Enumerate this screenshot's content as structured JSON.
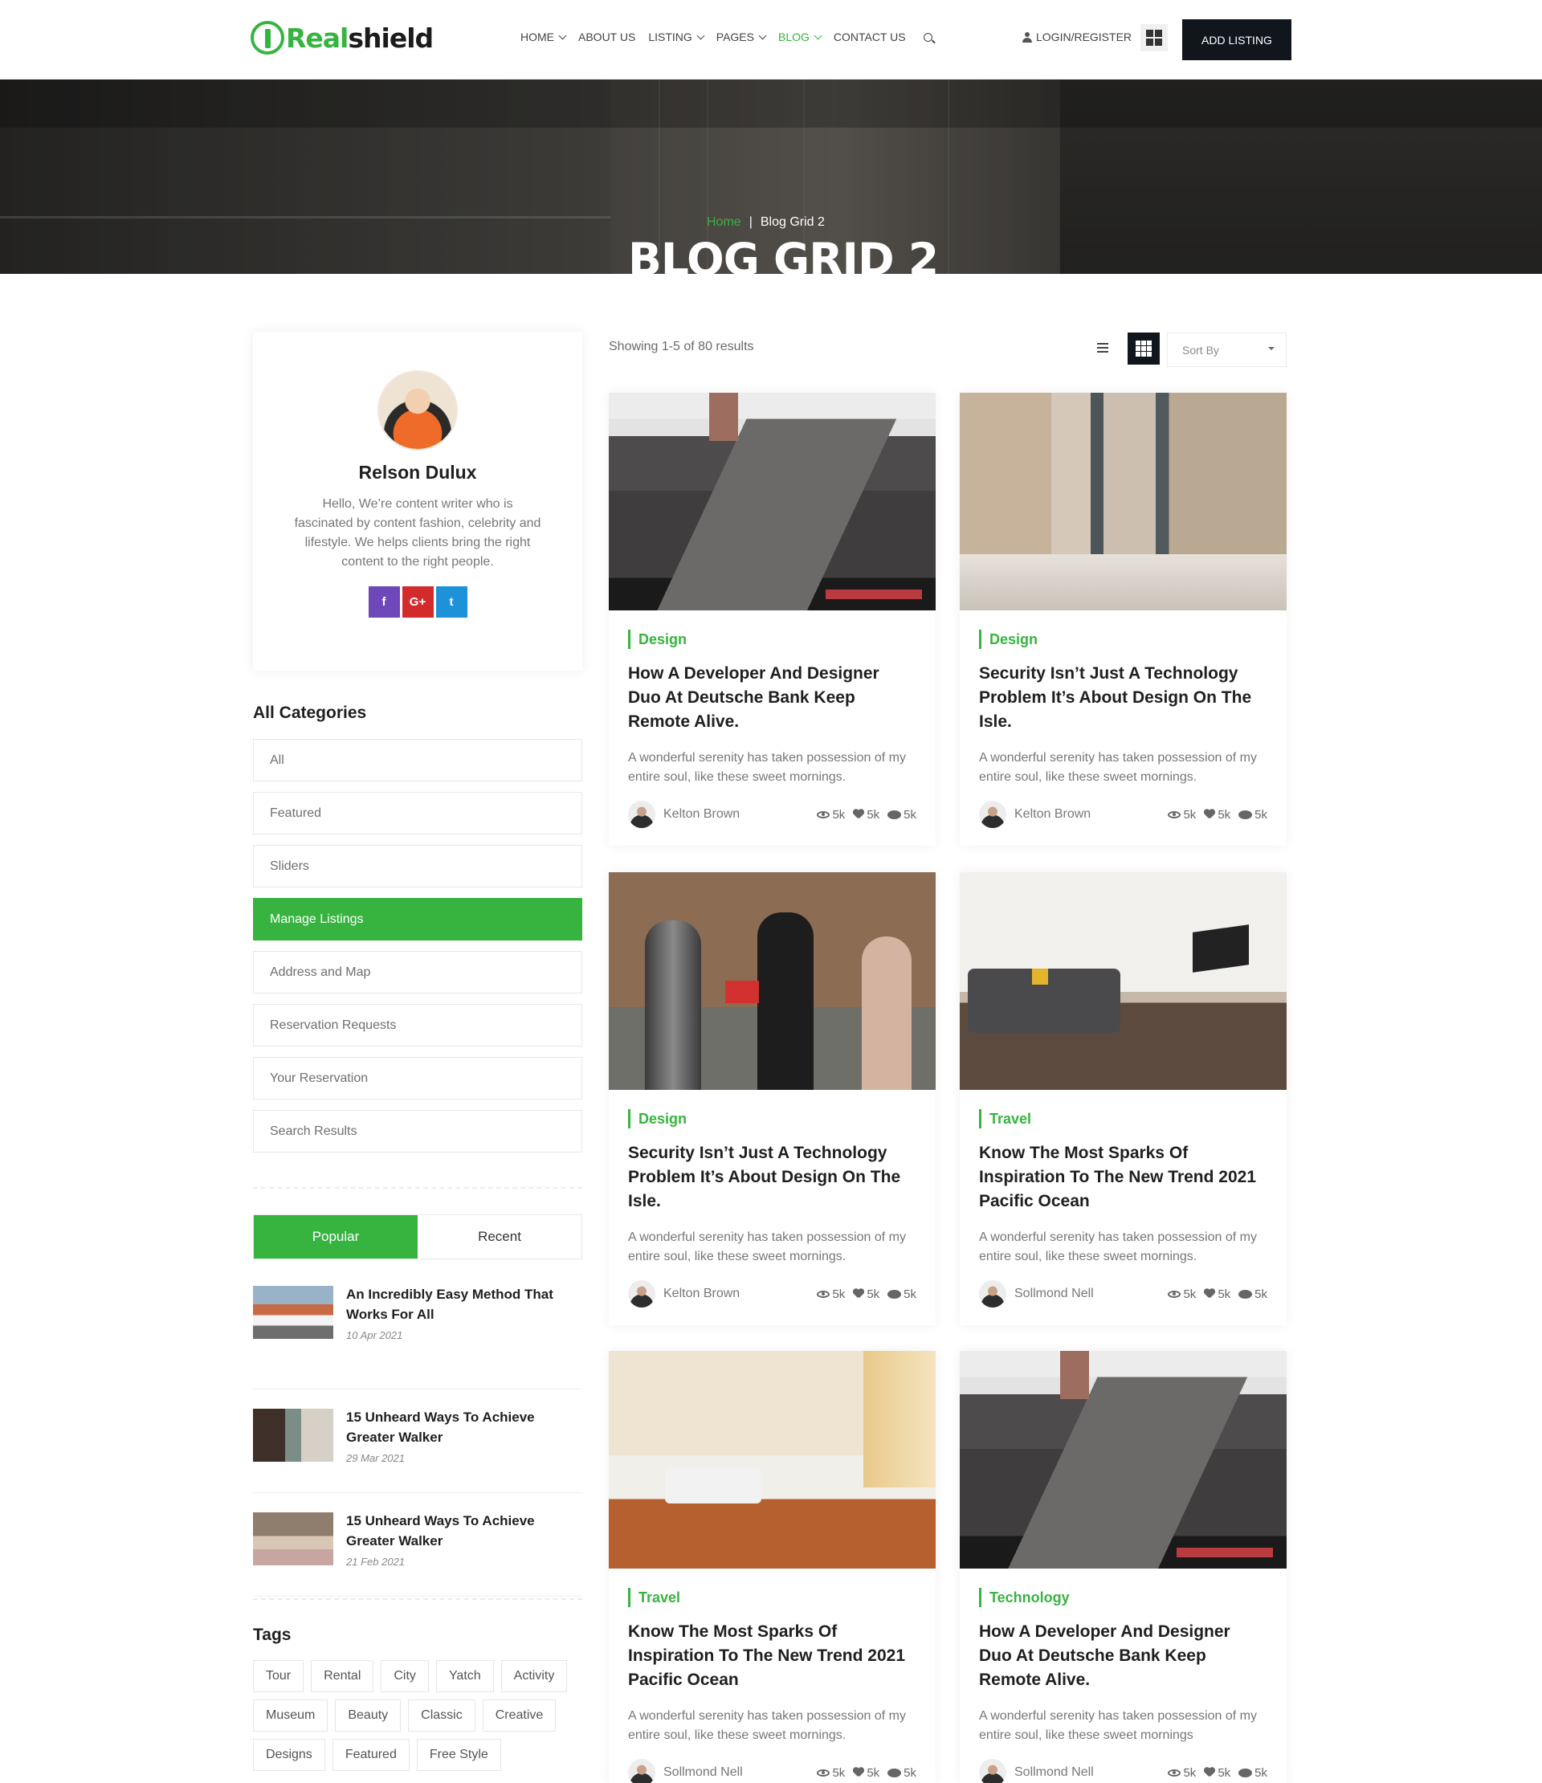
{
  "header": {
    "logo_part1": "Real",
    "logo_part2": "shield",
    "nav": [
      "HOME",
      "ABOUT US",
      "LISTING",
      "PAGES",
      "BLOG",
      "CONTACT US"
    ],
    "login": "LOGIN/REGISTER",
    "add_listing": "ADD LISTING"
  },
  "hero": {
    "breadcrumb_home": "Home",
    "breadcrumb_sep": "|",
    "breadcrumb_current": "Blog Grid 2",
    "title": "BLOG GRID 2"
  },
  "author": {
    "name": "Relson Dulux",
    "bio": "Hello, We’re content writer who is fascinated by content fashion, celebrity and lifestyle. We helps clients bring the right content to the right people.",
    "socials": [
      "f",
      "G+",
      "t"
    ]
  },
  "categories": {
    "title": "All Categories",
    "items": [
      "All",
      "Featured",
      "Sliders",
      "Manage Listings",
      "Address and Map",
      "Reservation Requests",
      "Your Reservation",
      "Search Results"
    ],
    "active": "Manage Listings"
  },
  "post_tabs": [
    "Popular",
    "Recent"
  ],
  "sidebar_posts": [
    {
      "title": "An Incredibly Easy Method That Works For All",
      "date": "10 Apr 2021"
    },
    {
      "title": "15 Unheard Ways To Achieve Greater Walker",
      "date": "29 Mar 2021"
    },
    {
      "title": "15 Unheard Ways To Achieve Greater Walker",
      "date": "21 Feb 2021"
    }
  ],
  "tags": {
    "title": "Tags",
    "items": [
      "Tour",
      "Rental",
      "City",
      "Yatch",
      "Activity",
      "Museum",
      "Beauty",
      "Classic",
      "Creative",
      "Designs",
      "Featured",
      "Free Style"
    ]
  },
  "toolbar": {
    "showing": "Showing 1-5 of 80 results",
    "sort_label": "Sort By"
  },
  "cards": [
    {
      "category": "Design",
      "title": "How A Developer And Designer Duo At Deutsche Bank Keep Remote Alive.",
      "excerpt": "A wonderful serenity has taken possession of my entire soul, like these sweet mornings.",
      "author": "Kelton Brown",
      "views": "5k",
      "likes": "5k",
      "comments": "5k"
    },
    {
      "category": "Design",
      "title": "Security Isn’t Just A Technology Problem It’s About Design On The Isle.",
      "excerpt": "A wonderful serenity has taken possession of my entire soul, like these sweet mornings.",
      "author": "Kelton Brown",
      "views": "5k",
      "likes": "5k",
      "comments": "5k"
    },
    {
      "category": "Design",
      "title": "Security Isn’t Just A Technology Problem It’s About Design On The Isle.",
      "excerpt": "A wonderful serenity has taken possession of my entire soul, like these sweet mornings.",
      "author": "Kelton Brown",
      "views": "5k",
      "likes": "5k",
      "comments": "5k"
    },
    {
      "category": "Travel",
      "title": "Know The Most Sparks Of Inspiration To The New Trend 2021 Pacific Ocean",
      "excerpt": "A wonderful serenity has taken possession of my entire soul, like these sweet mornings.",
      "author": "Sollmond Nell",
      "views": "5k",
      "likes": "5k",
      "comments": "5k"
    },
    {
      "category": "Travel",
      "title": "Know The Most Sparks Of Inspiration To The New Trend 2021 Pacific Ocean",
      "excerpt": "A wonderful serenity has taken possession of my entire soul, like these sweet mornings.",
      "author": "Sollmond Nell",
      "views": "5k",
      "likes": "5k",
      "comments": "5k"
    },
    {
      "category": "Technology",
      "title": "How A Developer And Designer Duo At Deutsche Bank Keep Remote Alive.",
      "excerpt": "A wonderful serenity has taken possession of my entire soul, like these sweet mornings",
      "author": "Sollmond Nell",
      "views": "5k",
      "likes": "5k",
      "comments": "5k"
    }
  ],
  "colors": {
    "accent": "#37b440",
    "dark": "#11161c",
    "facebook": "#6e47b8",
    "google": "#d32b2b",
    "twitter": "#1e92d8"
  }
}
